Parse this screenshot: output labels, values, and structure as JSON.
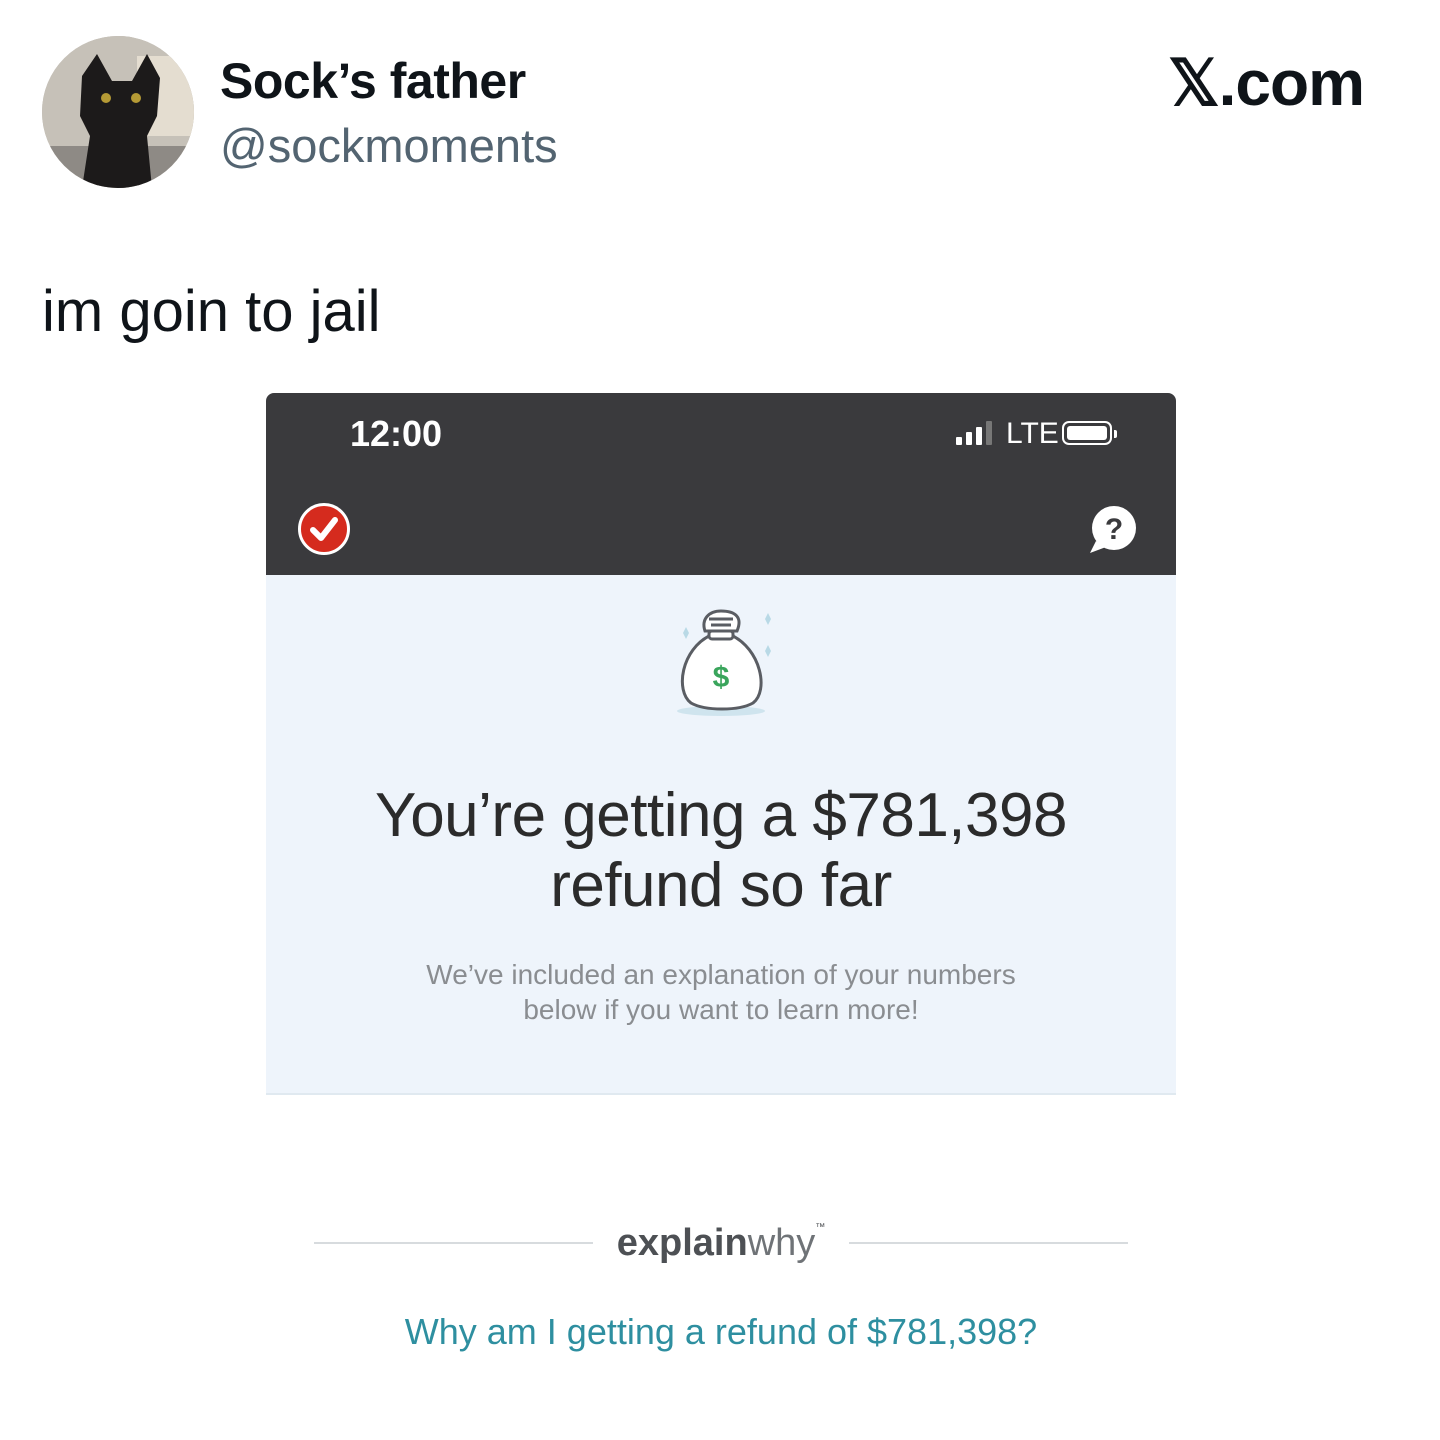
{
  "tweet": {
    "display_name": "Sock’s father",
    "handle": "@sockmoments",
    "brand": "𝕏.com",
    "text": "im goin to jail"
  },
  "screenshot": {
    "status_bar": {
      "time": "12:00",
      "network": "LTE"
    },
    "headline_line1": "You’re getting a $781,398",
    "headline_line2": "refund so far",
    "subtext_line1": "We’ve included an explanation of your numbers",
    "subtext_line2": "below if you want to learn more!",
    "explain_bold": "explain",
    "explain_light": "why",
    "explain_tm": "™",
    "link_text": "Why am I getting a refund of $781,398?"
  },
  "colors": {
    "status_bar_bg": "#3a3a3d",
    "hero_bg": "#eef4fb",
    "brand_red": "#d52b1e",
    "link_teal": "#2e8fa0",
    "money_green": "#3aa55c"
  },
  "icons": {
    "logo": "red-check-circle-icon",
    "help": "question-speech-bubble-icon",
    "illustration": "money-bag-icon",
    "signal": "cell-signal-icon",
    "battery": "battery-icon"
  }
}
